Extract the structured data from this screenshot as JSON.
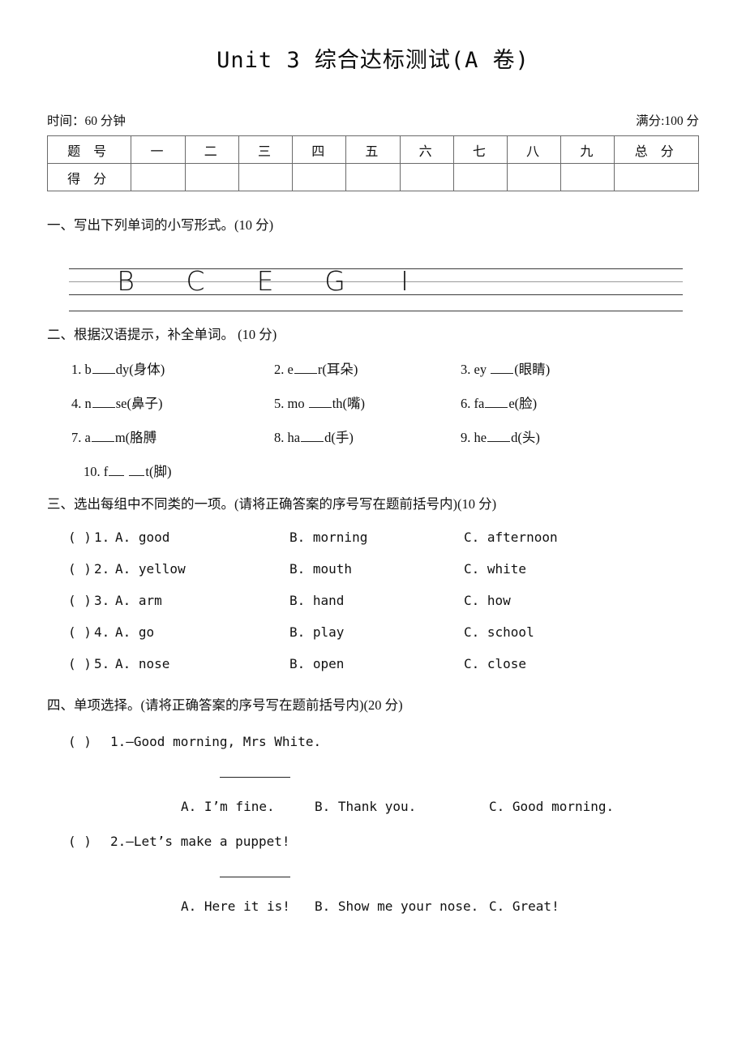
{
  "title": "Unit 3 综合达标测试(A 卷)",
  "meta": {
    "time": "时间：60 分钟",
    "full_score": "满分:100 分"
  },
  "score_table": {
    "row_labels": [
      "题 号",
      "得 分"
    ],
    "columns": [
      "一",
      "二",
      "三",
      "四",
      "五",
      "六",
      "七",
      "八",
      "九",
      "总 分"
    ],
    "scores": [
      "",
      "",
      "",
      "",
      "",
      "",
      "",
      "",
      "",
      ""
    ]
  },
  "sections": [
    {
      "id": "section-1",
      "heading": "一、写出下列单词的小写形式。(10 分)",
      "letters": [
        "B",
        "C",
        "E",
        "G",
        "I"
      ]
    },
    {
      "id": "section-2",
      "heading": "二、根据汉语提示，补全单词。 (10 分)",
      "items": [
        {
          "num": "1.",
          "pre": "b",
          "post": "dy(身体)",
          "blanks": 1
        },
        {
          "num": "2.",
          "pre": "e",
          "post": "r(耳朵)",
          "blanks": 1
        },
        {
          "num": "3.",
          "pre": "ey ",
          "post": "(眼睛)",
          "blanks": 1
        },
        {
          "num": "4.",
          "pre": "n",
          "post": "se(鼻子)",
          "blanks": 1
        },
        {
          "num": "5.",
          "pre": "mo ",
          "post": "th(嘴)",
          "blanks": 1
        },
        {
          "num": "6.",
          "pre": "fa",
          "post": "e(脸)",
          "blanks": 1
        },
        {
          "num": "7.",
          "pre": "a",
          "post": "m(胳膊",
          "blanks": 1
        },
        {
          "num": "8.",
          "pre": "ha",
          "post": "d(手)",
          "blanks": 1
        },
        {
          "num": "9.",
          "pre": "he",
          "post": "d(头)",
          "blanks": 1
        },
        {
          "num": "10.",
          "pre": "f",
          "post": "t(脚)",
          "blanks": 2
        }
      ]
    },
    {
      "id": "section-3",
      "heading": "三、选出每组中不同类的一项。(请将正确答案的序号写在题前括号内)(10 分)",
      "questions": [
        {
          "paren": "(    )",
          "num": "1.",
          "a": "A. good",
          "b": "B. morning",
          "c": "C. afternoon"
        },
        {
          "paren": "(    )",
          "num": "2.",
          "a": "A. yellow",
          "b": "B. mouth",
          "c": "C. white"
        },
        {
          "paren": "(    )",
          "num": "3.",
          "a": "A. arm",
          "b": "B. hand",
          "c": "C. how"
        },
        {
          "paren": "(    )",
          "num": "4.",
          "a": "A. go",
          "b": "B. play",
          "c": "C. school"
        },
        {
          "paren": "(    )",
          "num": "5.",
          "a": "A. nose",
          "b": "B. open",
          "c": "C. close"
        }
      ]
    },
    {
      "id": "section-4",
      "heading": "四、单项选择。(请将正确答案的序号写在题前括号内)(20 分)",
      "questions": [
        {
          "paren": "(    )",
          "stem": "1.—Good morning, Mrs White.",
          "a": "A. I’m fine.",
          "b": "B. Thank you.",
          "c": "C. Good morning."
        },
        {
          "paren": "(    )",
          "stem": "2.—Let’s make a puppet!",
          "a": "A. Here it is!",
          "b": "B. Show me your nose.",
          "c": "C. Great!"
        }
      ]
    }
  ]
}
